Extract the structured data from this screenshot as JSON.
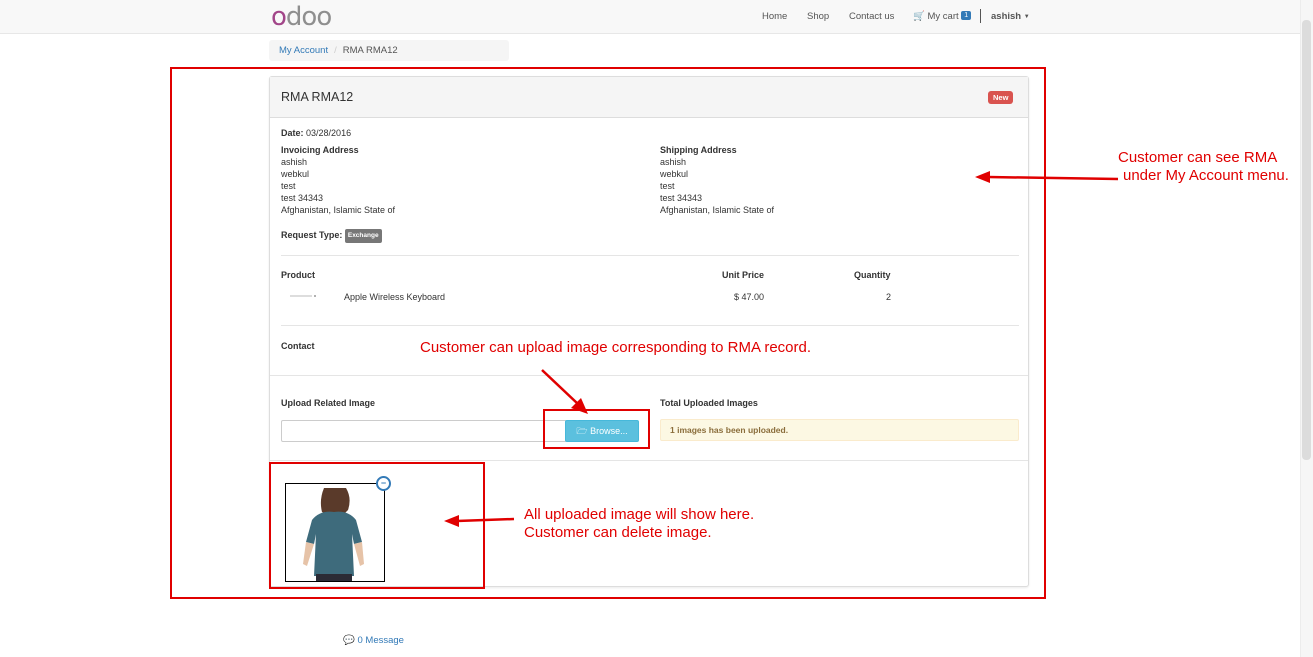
{
  "navbar": {
    "logo_first": "o",
    "logo_rest": "doo",
    "links": [
      "Home",
      "Shop",
      "Contact us"
    ],
    "cart_label": "My cart",
    "cart_count": "1",
    "user": "ashish"
  },
  "breadcrumb": {
    "parent": "My Account",
    "separator": "/",
    "current": "RMA RMA12"
  },
  "panel": {
    "title": "RMA RMA12",
    "status": "New",
    "date_label": "Date:",
    "date_value": "03/28/2016",
    "invoicing": {
      "heading": "Invoicing Address",
      "lines": [
        "ashish",
        "webkul",
        "test",
        "test 34343",
        "Afghanistan, Islamic State of"
      ]
    },
    "shipping": {
      "heading": "Shipping Address",
      "lines": [
        "ashish",
        "webkul",
        "test",
        "test 34343",
        "Afghanistan, Islamic State of"
      ]
    },
    "request_type_label": "Request Type:",
    "request_type_value": "Exchange",
    "table": {
      "headers": [
        "Product",
        "Unit Price",
        "Quantity"
      ],
      "row": {
        "product": "Apple Wireless Keyboard",
        "unit_price": "$ 47.00",
        "quantity": "2"
      }
    },
    "contact_label": "Contact",
    "upload_label": "Upload Related Image",
    "browse_label": "Browse...",
    "total_label": "Total Uploaded Images",
    "total_message": "1 images has been uploaded."
  },
  "message_link": "0 Message",
  "annotations": {
    "account_line1": "Customer can see RMA",
    "account_line2": "under My Account menu.",
    "upload": "Customer can upload image corresponding to RMA record.",
    "gallery_line1": "All uploaded image will show here.",
    "gallery_line2": "Customer can delete image."
  },
  "colors": {
    "annotation": "#e00000",
    "link": "#337ab7",
    "new_badge": "#d9534f",
    "browse_button": "#5bc0de",
    "alert_bg": "#fcf8e3",
    "logo_accent": "#a24689"
  },
  "icons": [
    "cart-icon",
    "caret-down-icon",
    "folder-open-icon",
    "delete-image-icon",
    "comment-icon"
  ]
}
